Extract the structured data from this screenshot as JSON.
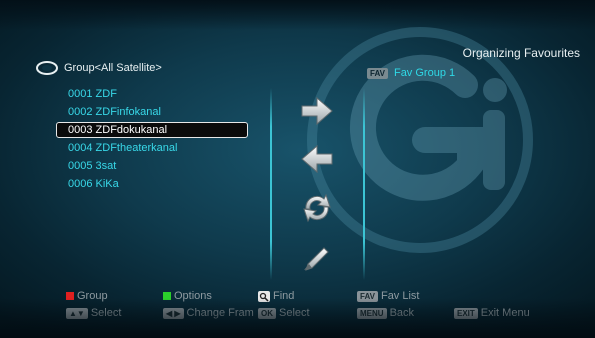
{
  "title": "Organizing Favourites",
  "group_header": {
    "icon": "satellite-dish-icon",
    "label": "Group<All Satellite>"
  },
  "fav_header": {
    "tag": "FAV",
    "label": "Fav Group 1"
  },
  "channels": [
    {
      "label": "0001  ZDF"
    },
    {
      "label": "0002  ZDFinfokanal"
    },
    {
      "label": "0003  ZDFdokukanal",
      "selected": true
    },
    {
      "label": "0004  ZDFtheaterkanal"
    },
    {
      "label": "0005  3sat"
    },
    {
      "label": "0006  KiKa"
    }
  ],
  "actions": [
    "move-right-icon",
    "move-left-icon",
    "swap-icon",
    "edit-icon"
  ],
  "footer": {
    "group": "Group",
    "options": "Options",
    "find": "Find",
    "fav_btn": "FAV",
    "fav_list": "Fav List",
    "select": "Select",
    "change_frame": "Change Fram",
    "ok_btn": "OK",
    "ok_select": "Select",
    "menu_btn": "MENU",
    "back": "Back",
    "exit_btn": "EXIT",
    "exit_menu": "Exit Menu"
  },
  "colors": {
    "red": "#e02020",
    "green": "#2bd02b",
    "cyan": "#38d8e8"
  }
}
